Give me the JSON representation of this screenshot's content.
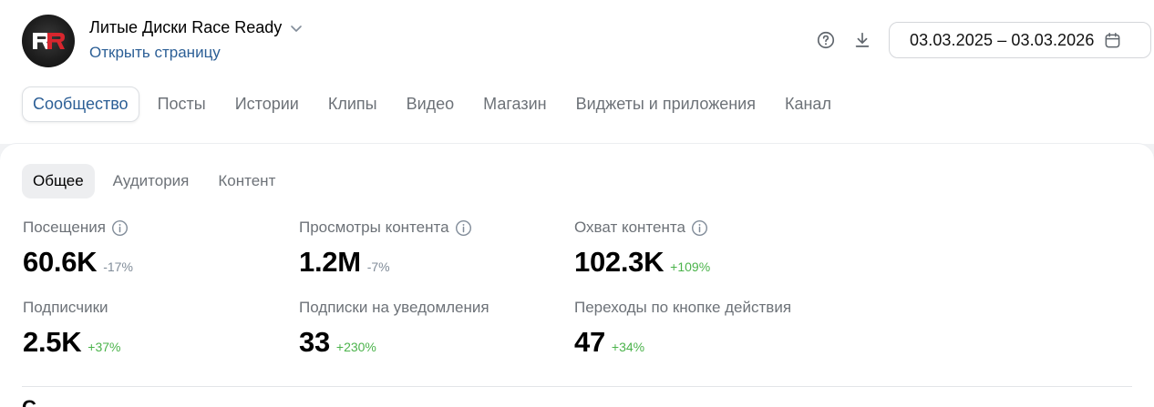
{
  "header": {
    "group_name": "Литые Диски Race Ready",
    "open_page_link": "Открыть страницу",
    "date_range": "03.03.2025 – 03.03.2026"
  },
  "main_tabs": [
    {
      "label": "Сообщество",
      "active": true
    },
    {
      "label": "Посты",
      "active": false
    },
    {
      "label": "Истории",
      "active": false
    },
    {
      "label": "Клипы",
      "active": false
    },
    {
      "label": "Видео",
      "active": false
    },
    {
      "label": "Магазин",
      "active": false
    },
    {
      "label": "Виджеты и приложения",
      "active": false
    },
    {
      "label": "Канал",
      "active": false
    }
  ],
  "sub_tabs": [
    {
      "label": "Общее",
      "active": true
    },
    {
      "label": "Аудитория",
      "active": false
    },
    {
      "label": "Контент",
      "active": false
    }
  ],
  "metrics": [
    {
      "label": "Посещения",
      "value": "60.6K",
      "change": "-17%",
      "trend": "negative",
      "has_info": true
    },
    {
      "label": "Просмотры контента",
      "value": "1.2M",
      "change": "-7%",
      "trend": "negative",
      "has_info": true
    },
    {
      "label": "Охват контента",
      "value": "102.3K",
      "change": "+109%",
      "trend": "positive",
      "has_info": true
    },
    {
      "label": "Подписчики",
      "value": "2.5K",
      "change": "+37%",
      "trend": "positive",
      "has_info": false
    },
    {
      "label": "Подписки на уведомления",
      "value": "33",
      "change": "+230%",
      "trend": "positive",
      "has_info": false
    },
    {
      "label": "Переходы по кнопке действия",
      "value": "47",
      "change": "+34%",
      "trend": "positive",
      "has_info": false
    }
  ],
  "next_section": {
    "title_fragment": "С"
  },
  "colors": {
    "accent": "#2c5f96",
    "positive": "#4bb34b",
    "negative": "#818c99",
    "muted_text": "#6d7278",
    "logo_red": "#d8262e"
  },
  "icons": {
    "help": "help-circle-icon",
    "download": "download-icon",
    "calendar": "calendar-icon",
    "info": "info-circle-icon",
    "chevron": "chevron-down-icon"
  }
}
